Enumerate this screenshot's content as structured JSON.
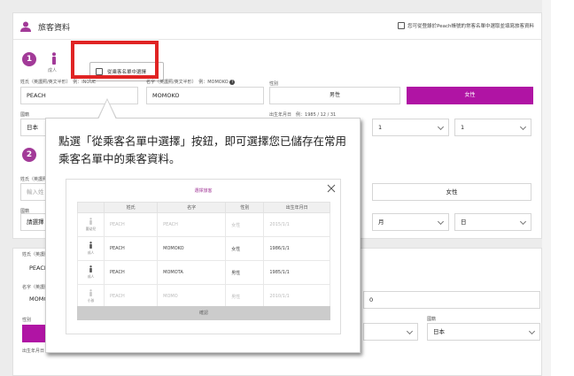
{
  "header": {
    "title": "旅客資料",
    "right_text": "您可從登錄於Peach帳號的常客名單中選取並填寫旅客資料"
  },
  "steps": [
    "1",
    "2"
  ],
  "passenger": {
    "type_label": "成人",
    "select_button": "從乘客名單中選擇",
    "surname_label": "姓氏（英護照/英文半形）",
    "surname_hint": "例：INOUE",
    "surname_value": "PEACH",
    "given_label": "名字（英護照/英文半形）",
    "given_hint": "例：MOMOKO",
    "given_value": "MOMOKO",
    "gender_label": "性別",
    "gender_male": "男性",
    "gender_female": "女性",
    "nationality_label": "國籍",
    "nationality_value": "日本",
    "birth_label": "出生年月日",
    "birth_hint": "例：1985 / 12 / 31",
    "birth_month": "1",
    "birth_day": "1"
  },
  "passenger2": {
    "surname_label": "姓氏（英護照/英",
    "surname_placeholder": "輸入姓",
    "nationality_label": "國籍",
    "nationality_value": "請選擇",
    "gender_female": "女性",
    "month_label": "月",
    "day_label": "日"
  },
  "lower": {
    "surname_label": "姓氏（英護照/",
    "surname_value": "PEACH",
    "given_label": "名字（英護照/",
    "given_value": "MOMO",
    "gender_label": "性別",
    "nationality_label": "國籍",
    "nationality_value": "日本",
    "birth_label": "出生年月日",
    "birth_fragment": "0"
  },
  "callout": {
    "text": "點選「從乘客名單中選擇」按鈕，即可選擇您已儲存在常用乘客名單中的乘客資料。"
  },
  "modal": {
    "title": "選擇旅客",
    "columns": [
      "",
      "姓氏",
      "名字",
      "性別",
      "出生年月日"
    ],
    "rows": [
      {
        "type": "嬰幼兒",
        "surname": "PEACH",
        "given": "PEACH",
        "gender": "女性",
        "birth": "2015/1/1",
        "faded": true
      },
      {
        "type": "成人",
        "surname": "PEACH",
        "given": "MOMOKO",
        "gender": "女性",
        "birth": "1986/1/1",
        "faded": false
      },
      {
        "type": "成人",
        "surname": "PEACH",
        "given": "MOMOTA",
        "gender": "男性",
        "birth": "1985/1/1",
        "faded": false
      },
      {
        "type": "小孩",
        "surname": "PEACH",
        "given": "MOMO",
        "gender": "男性",
        "birth": "2010/1/1",
        "faded": true
      }
    ],
    "confirm_button": "確認"
  },
  "colors": {
    "accent": "#b014a4",
    "step": "#a23a98",
    "highlight": "#e02424"
  }
}
